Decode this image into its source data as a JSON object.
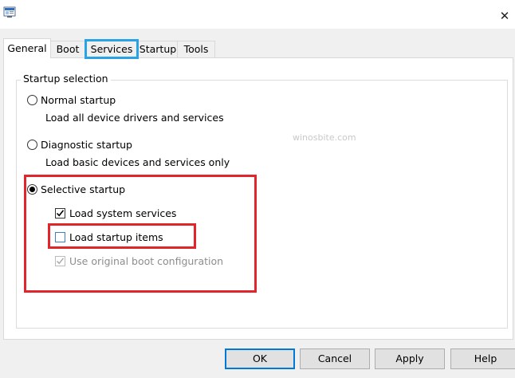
{
  "window": {
    "app_icon": "msconfig-icon",
    "close_glyph": "✕",
    "close_icon": "close-icon"
  },
  "tabs": [
    {
      "label": "General",
      "active": true
    },
    {
      "label": "Boot"
    },
    {
      "label": "Services",
      "highlighted": true
    },
    {
      "label": "Startup"
    },
    {
      "label": "Tools"
    }
  ],
  "startup_selection": {
    "group_label": "Startup selection",
    "normal": {
      "label": "Normal startup",
      "description": "Load all device drivers and services",
      "selected": false
    },
    "diagnostic": {
      "label": "Diagnostic startup",
      "description": "Load basic devices and services only",
      "selected": false
    },
    "selective": {
      "label": "Selective startup",
      "selected": true,
      "options": {
        "load_system_services": {
          "label": "Load system services",
          "checked": true,
          "enabled": true
        },
        "load_startup_items": {
          "label": "Load startup items",
          "checked": false,
          "enabled": true
        },
        "use_original_boot": {
          "label": "Use original boot configuration",
          "checked": true,
          "enabled": false
        }
      }
    }
  },
  "watermark": "winosbite.com",
  "buttons": {
    "ok": "OK",
    "cancel": "Cancel",
    "apply": "Apply",
    "help": "Help"
  },
  "colors": {
    "highlight_red": "#e0262b",
    "highlight_blue": "#2aa3e6",
    "default_button_border": "#0078d7"
  }
}
